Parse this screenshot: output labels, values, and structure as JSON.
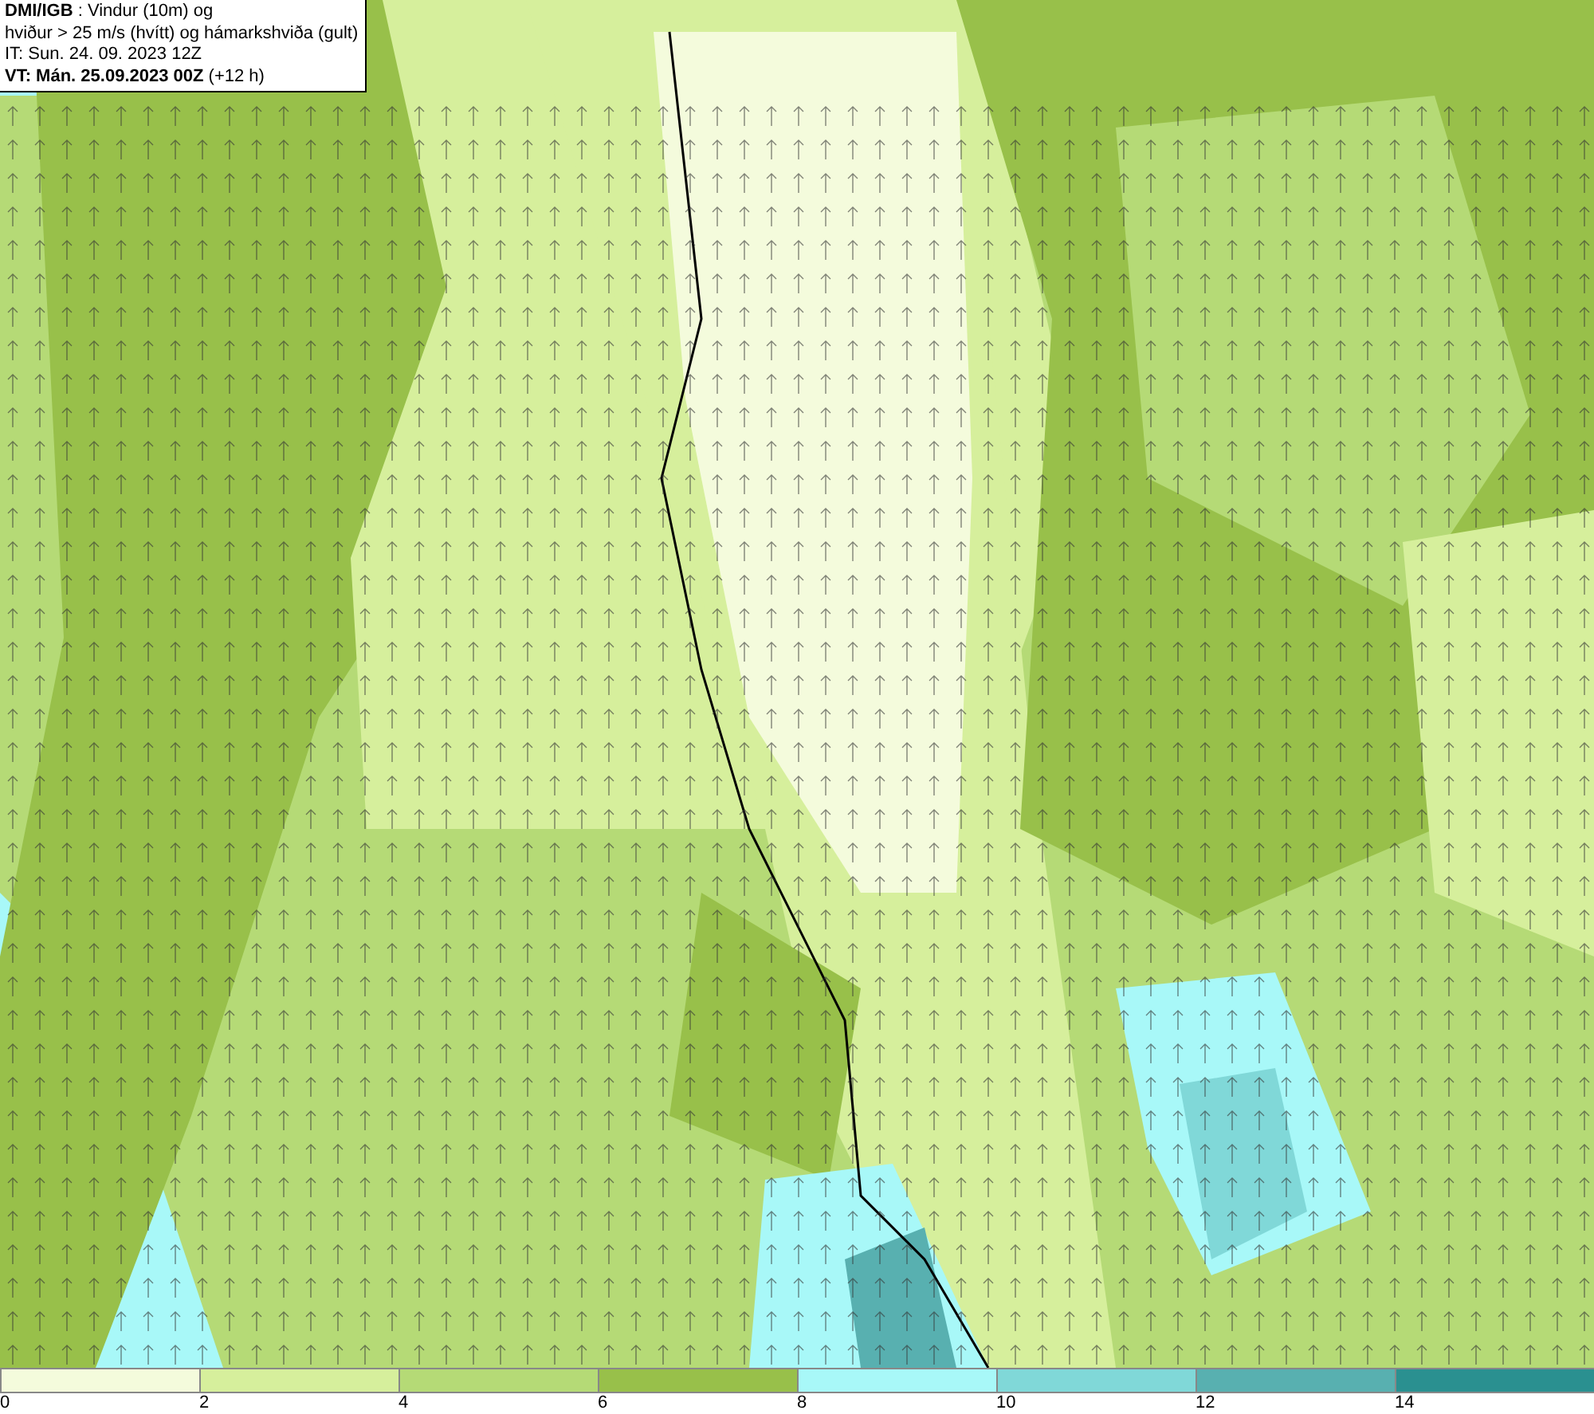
{
  "title_box": {
    "lines": [
      "**DMI/IGB** : Vindur (10m) og",
      "hviður > 25 m/s (hvítt) og hámarkshviða (gult)",
      "IT: Sun. 24. 09. 2023 12Z",
      "**VT: Mán. 25.09.2023 00Z** (+12 h)"
    ]
  },
  "legend": {
    "bands": [
      {
        "color": "#f4fbdc"
      },
      {
        "color": "#d6ef9c"
      },
      {
        "color": "#b5da76"
      },
      {
        "color": "#98c04a"
      },
      {
        "color": "#a8f8f8"
      },
      {
        "color": "#80d8d8"
      },
      {
        "color": "#58b0b0"
      },
      {
        "color": "#2a9090"
      }
    ],
    "ticks": [
      "0",
      "2",
      "4",
      "6",
      "8",
      "10",
      "12",
      "14"
    ]
  }
}
